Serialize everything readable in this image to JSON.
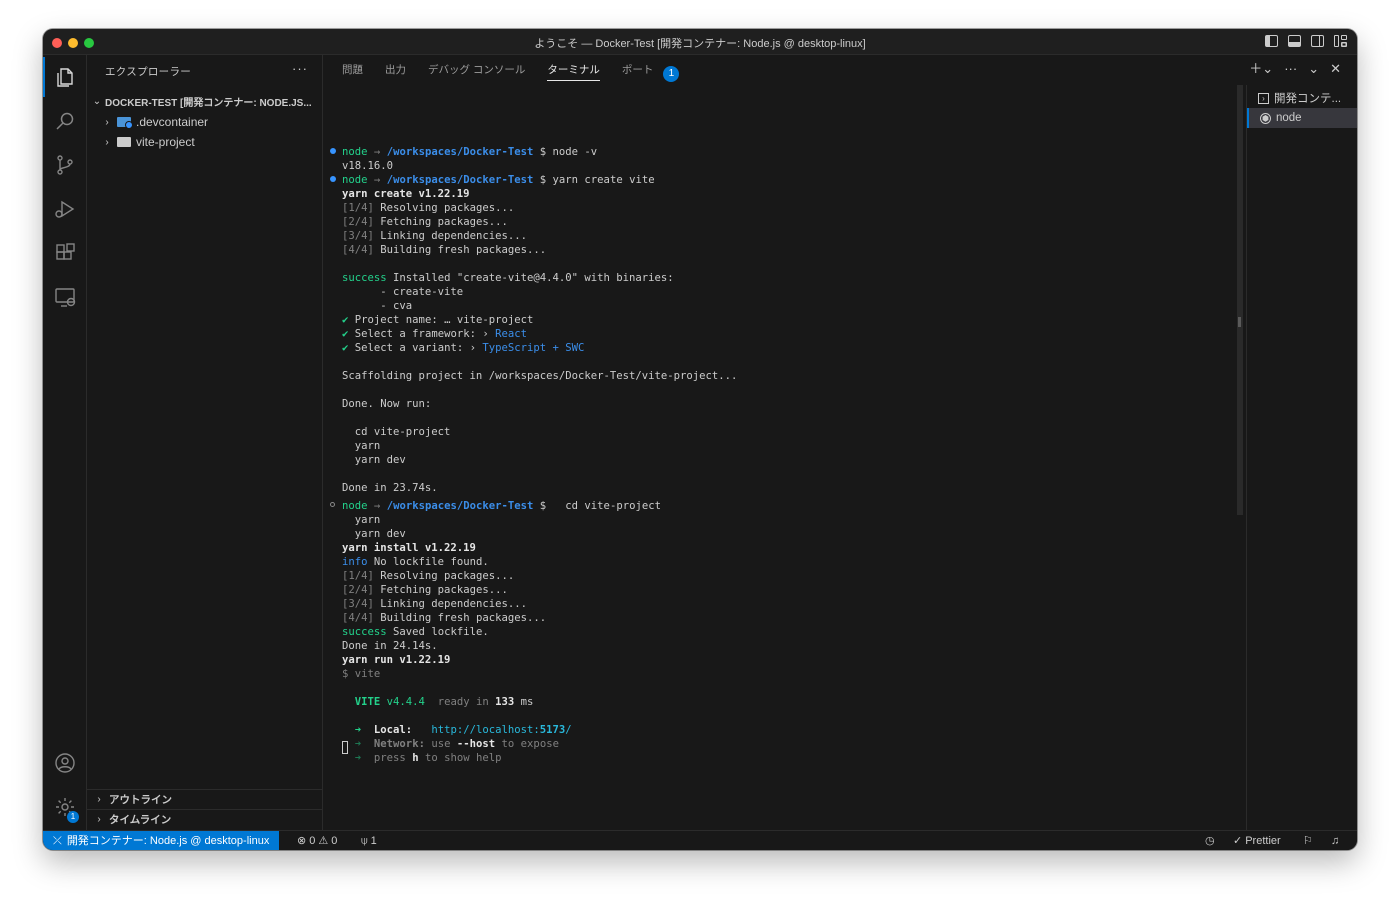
{
  "window": {
    "title": "ようこそ — Docker-Test [開発コンテナー: Node.js @ desktop-linux]"
  },
  "sidebar": {
    "header": "エクスプローラー",
    "more": "···",
    "workspace": "DOCKER-TEST [開発コンテナー: NODE.JS...",
    "items": [
      {
        "label": ".devcontainer",
        "icon": "devcontainer-folder-icon"
      },
      {
        "label": "vite-project",
        "icon": "folder-icon"
      }
    ],
    "outline": "アウトライン",
    "timeline": "タイムライン"
  },
  "panel": {
    "tabs": [
      "問題",
      "出力",
      "デバッグ コンソール",
      "ターミナル",
      "ポート"
    ],
    "active_tab": "ターミナル",
    "ports_count": "1"
  },
  "terminal": {
    "lines": [
      "node",
      "/workspaces/Docker-Test",
      "$ node -v",
      "v18.16.0",
      "$ yarn create vite",
      "yarn create v1.22.19",
      "[1/4]",
      "Resolving packages...",
      "[2/4]",
      "Fetching packages...",
      "[3/4]",
      "Linking dependencies...",
      "[4/4]",
      "Building fresh packages...",
      "success",
      "Installed \"create-vite@4.4.0\" with binaries:",
      "      - create-vite",
      "      - cva",
      "✔",
      "Project name: … vite-project",
      "Select a framework: ›",
      "React",
      "Select a variant: ›",
      "TypeScript + SWC",
      "Scaffolding project in /workspaces/Docker-Test/vite-project...",
      "Done. Now run:",
      "  cd vite-project",
      "  yarn",
      "  yarn dev",
      "Done in 23.74s.",
      "$   cd vite-project",
      "yarn install v1.22.19",
      "info",
      "No lockfile found.",
      "Saved lockfile.",
      "Done in 24.14s.",
      "yarn run v1.22.19",
      "$ vite",
      "VITE",
      "v4.4.4",
      "ready in",
      "133",
      "ms",
      "➜",
      "Local:",
      "http://localhost:",
      "5173",
      "/",
      "Network:",
      "use",
      "--host",
      "to expose",
      "press",
      "h",
      "to show help"
    ]
  },
  "terminal_list": [
    {
      "label": "開発コンテ...",
      "icon": "dev-container-terminal-icon"
    },
    {
      "label": "node",
      "icon": "node-icon"
    }
  ],
  "statusbar": {
    "remote": "開発コンテナー: Node.js @ desktop-linux",
    "errors": "0",
    "warnings": "0",
    "ports": "1",
    "prettier": "Prettier"
  },
  "colors": {
    "accent": "#0078d4",
    "green": "#23d18b",
    "blue": "#3b8eea",
    "background": "#181818"
  }
}
